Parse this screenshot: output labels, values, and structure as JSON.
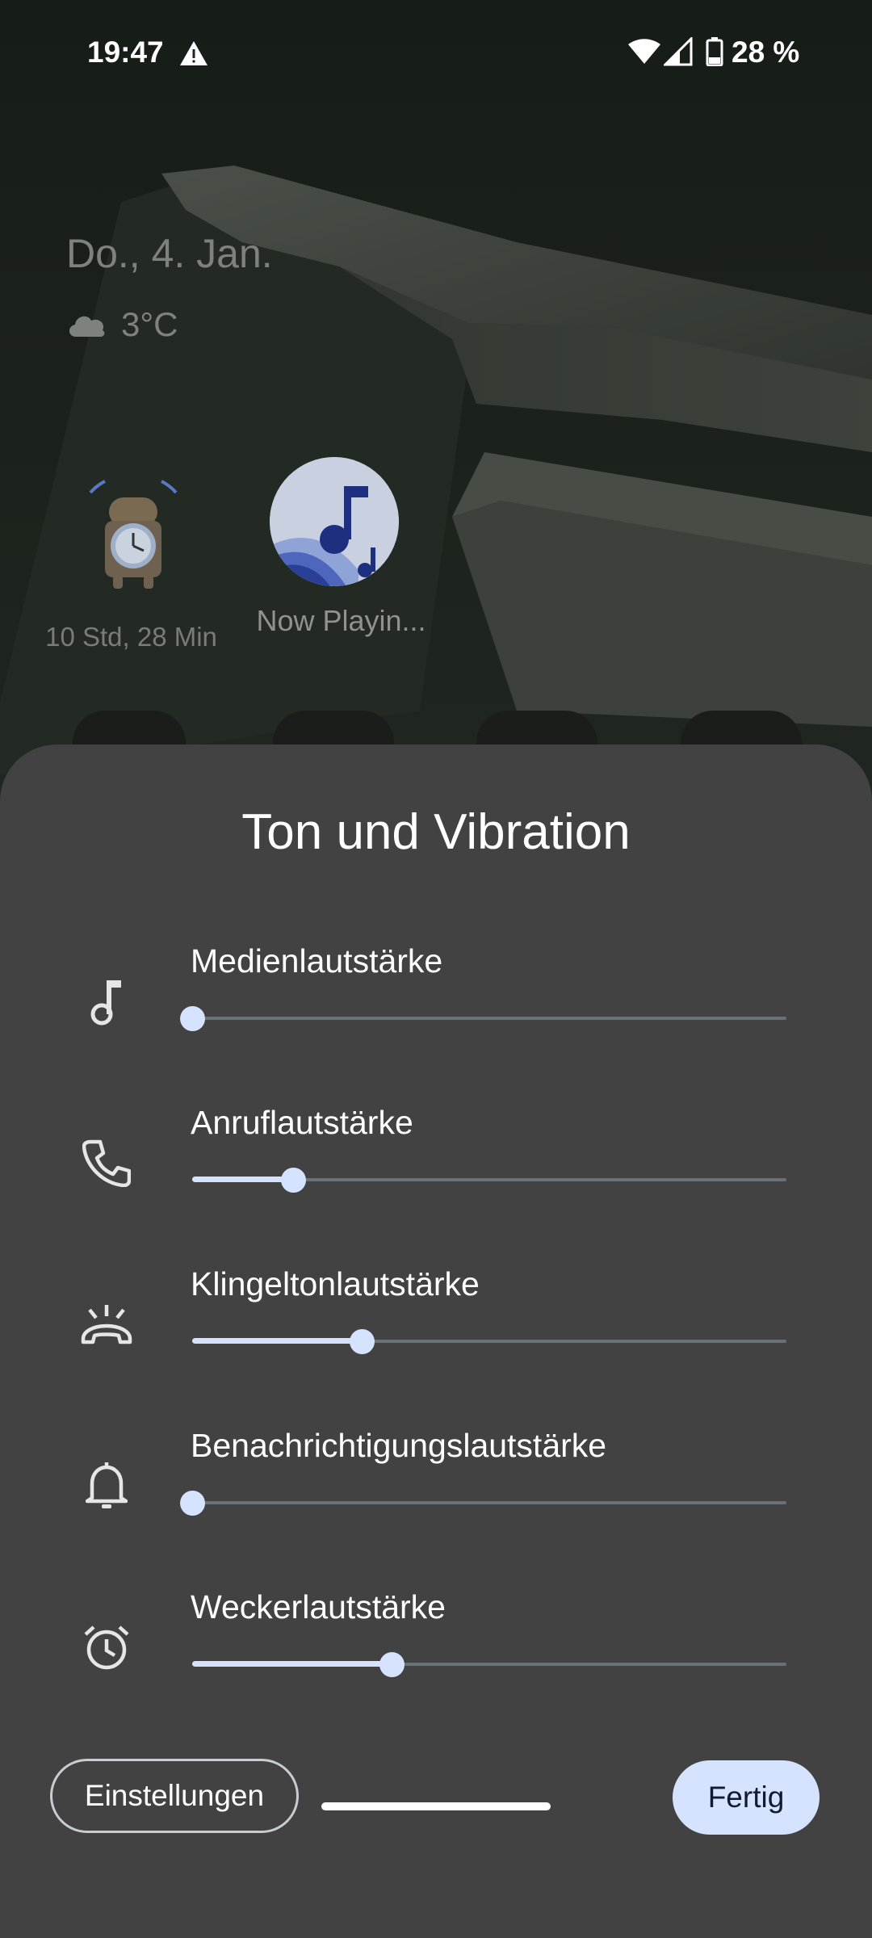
{
  "status_bar": {
    "time": "19:47",
    "battery": "28 %",
    "icons": [
      "alert-triangle-icon",
      "wifi-icon",
      "cell-signal-icon",
      "battery-icon"
    ]
  },
  "home": {
    "date": "Do., 4. Jan.",
    "temperature": "3°C",
    "apps": [
      {
        "label": "10 Std, 28 Min",
        "icon": "android-alarm-clock-icon"
      },
      {
        "label": "Now Playin...",
        "icon": "now-playing-music-note-icon"
      }
    ]
  },
  "sheet": {
    "title": "Ton und Vibration",
    "volumes": [
      {
        "label": "Medienlautstärke",
        "icon": "music-note-icon",
        "level": 0.0
      },
      {
        "label": "Anruflautstärke",
        "icon": "phone-icon",
        "level": 0.17
      },
      {
        "label": "Klingeltonlautstärke",
        "icon": "ringer-icon",
        "level": 0.285
      },
      {
        "label": "Benachrichtigungslautstärke",
        "icon": "bell-icon",
        "level": 0.0
      },
      {
        "label": "Weckerlautstärke",
        "icon": "alarm-clock-icon",
        "level": 0.335
      }
    ],
    "settings_button": "Einstellungen",
    "done_button": "Fertig"
  },
  "colors": {
    "sheet_background": "#424242",
    "slider_accent": "#d6e3ff",
    "slider_track": "#6a7078"
  }
}
